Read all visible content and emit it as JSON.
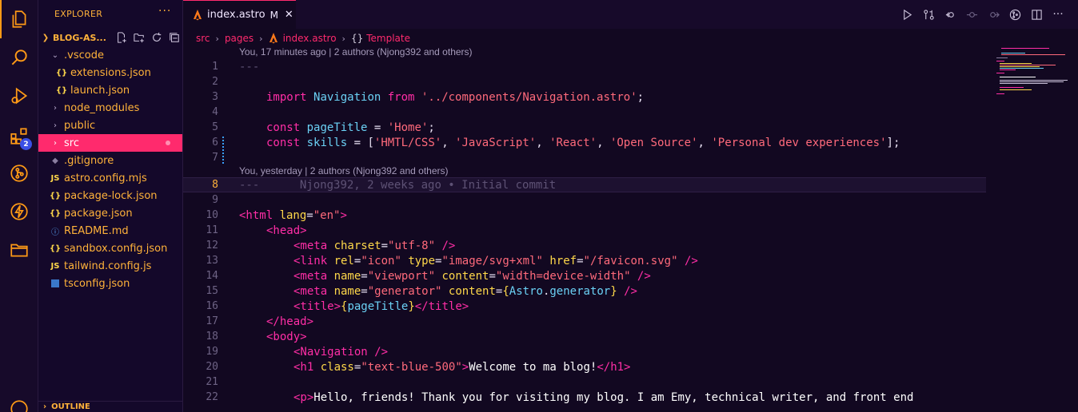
{
  "sidebar": {
    "title": "EXPLORER",
    "more": "···",
    "project": "BLOG-AS...",
    "tree": [
      {
        "label": ".vscode",
        "icon": "chevron-down",
        "indent": 1
      },
      {
        "label": "extensions.json",
        "icon": "json",
        "indent": 2
      },
      {
        "label": "launch.json",
        "icon": "json",
        "indent": 2
      },
      {
        "label": "node_modules",
        "icon": "chevron-right",
        "indent": 1
      },
      {
        "label": "public",
        "icon": "chevron-right",
        "indent": 1
      },
      {
        "label": "src",
        "icon": "chevron-right",
        "indent": 1,
        "selected": true
      },
      {
        "label": ".gitignore",
        "icon": "git",
        "indent": 1
      },
      {
        "label": "astro.config.mjs",
        "icon": "js",
        "indent": 1
      },
      {
        "label": "package-lock.json",
        "icon": "json",
        "indent": 1
      },
      {
        "label": "package.json",
        "icon": "json",
        "indent": 1
      },
      {
        "label": "README.md",
        "icon": "info",
        "indent": 1
      },
      {
        "label": "sandbox.config.json",
        "icon": "json",
        "indent": 1
      },
      {
        "label": "tailwind.config.js",
        "icon": "js",
        "indent": 1
      },
      {
        "label": "tsconfig.json",
        "icon": "ts",
        "indent": 1
      }
    ],
    "outline": "OUTLINE"
  },
  "activity": {
    "extensions_badge": "2"
  },
  "tab": {
    "name": "index.astro",
    "modified": "M",
    "close": "✕"
  },
  "breadcrumb": {
    "src": "src",
    "pages": "pages",
    "file": "index.astro",
    "symbol": "Template",
    "symbol_icon": "{}"
  },
  "codelens": {
    "first": "You, 17 minutes ago | 2 authors (Njong392 and others)",
    "second": "You, yesterday | 2 authors (Njong392 and others)"
  },
  "code": {
    "l1": "---",
    "l3a": "import",
    "l3b": "Navigation",
    "l3c": "from",
    "l3d": "'../components/Navigation.astro'",
    "l3e": ";",
    "l5a": "const",
    "l5b": "pageTitle",
    "l5c": " = ",
    "l5d": "'Home'",
    "l5e": ";",
    "l6a": "const",
    "l6b": "skills",
    "l6c": " = [",
    "l6d": "'HMTL/CSS'",
    "l6e": ", ",
    "l6f": "'JavaScript'",
    "l6g": ", ",
    "l6h": "'React'",
    "l6i": ", ",
    "l6j": "'Open Source'",
    "l6k": ", ",
    "l6l": "'Personal dev experiences'",
    "l6m": "];",
    "l8a": "---",
    "l8b": "      Njong392, 2 weeks ago • Initial commit",
    "l10": {
      "open": "<html ",
      "attr": "lang",
      "eq": "=",
      "val": "\"en\"",
      "close": ">"
    },
    "l11": "<head>",
    "l12": {
      "tag": "<meta ",
      "attr": "charset",
      "eq": "=",
      "val": "\"utf-8\"",
      "close": " />"
    },
    "l13": {
      "tag": "<link ",
      "a1": "rel",
      "v1": "\"icon\"",
      "a2": "type",
      "v2": "\"image/svg+xml\"",
      "a3": "href",
      "v3": "\"/favicon.svg\"",
      "close": " />"
    },
    "l14": {
      "tag": "<meta ",
      "a1": "name",
      "v1": "\"viewport\"",
      "a2": "content",
      "v2": "\"width=device-width\"",
      "close": " />"
    },
    "l15": {
      "tag": "<meta ",
      "a1": "name",
      "v1": "\"generator\"",
      "a2": "content",
      "b1": "{",
      "id1": "Astro",
      "dot": ".",
      "id2": "generator",
      "b2": "}",
      "close": " />"
    },
    "l16": {
      "open": "<title>",
      "b1": "{",
      "id": "pageTitle",
      "b2": "}",
      "close": "</title>"
    },
    "l17": "</head>",
    "l18": "<body>",
    "l19": "<Navigation />",
    "l20": {
      "open": "<h1 ",
      "attr": "class",
      "eq": "=",
      "val": "\"text-blue-500\"",
      "gt": ">",
      "text": "Welcome to ma blog!",
      "close": "</h1>"
    },
    "l22": {
      "open": "<p>",
      "text": "Hello, friends! Thank you for visiting my blog. I am Emy, technical writer, and front end"
    }
  },
  "line_numbers": [
    "1",
    "2",
    "3",
    "4",
    "5",
    "6",
    "7",
    "8",
    "9",
    "10",
    "11",
    "12",
    "13",
    "14",
    "15",
    "16",
    "17",
    "18",
    "19",
    "20",
    "21",
    "22"
  ],
  "colors": {
    "accent": "#ff2a6d",
    "folder": "#ffb23a",
    "background": "#120821"
  }
}
